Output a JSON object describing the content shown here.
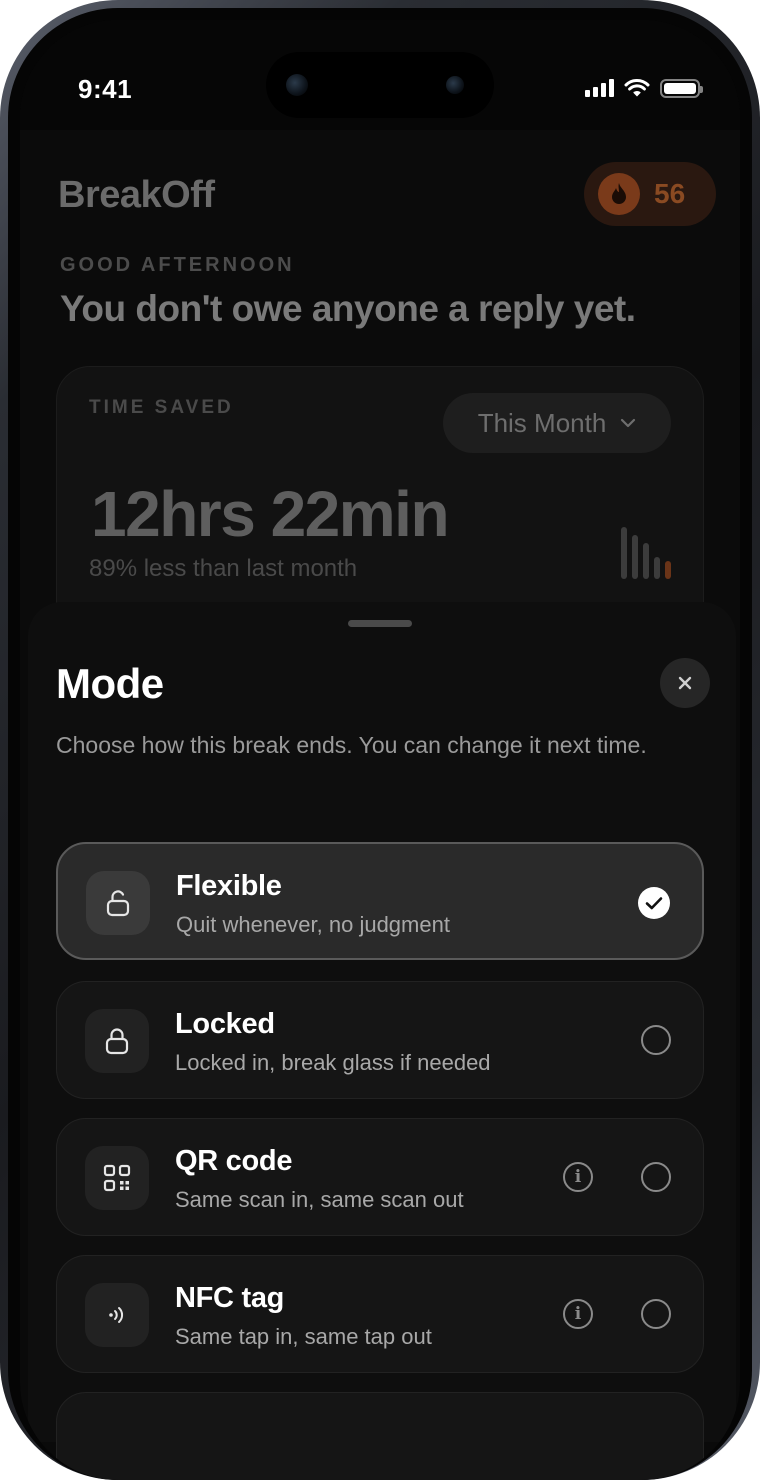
{
  "status_bar": {
    "time": "9:41"
  },
  "app": {
    "logo": "BreakOff",
    "streak_count": "56",
    "greeting": "GOOD AFTERNOON",
    "tagline": "You don't owe anyone a reply yet.",
    "time_saved_card": {
      "label": "TIME SAVED",
      "period": "This Month",
      "total": "12hrs 22min",
      "comparison": "89% less than last month"
    }
  },
  "sheet": {
    "title": "Mode",
    "subtitle": "Choose how this break ends. You can change it next time.",
    "options": [
      {
        "name": "Flexible",
        "description": "Quit whenever, no judgment",
        "icon": "unlock-icon",
        "selected": true
      },
      {
        "name": "Locked",
        "description": "Locked in, break glass if needed",
        "icon": "lock-icon",
        "selected": false
      },
      {
        "name": "QR code",
        "description": "Same scan in, same scan out",
        "icon": "qr-code-icon",
        "selected": false
      },
      {
        "name": "NFC tag",
        "description": "Same tap in, same tap out",
        "icon": "nfc-icon",
        "selected": false
      }
    ]
  },
  "colors": {
    "accent_orange": "#7a3a1a",
    "background": "#0a0a0a",
    "selected_border": "#5a5a5a"
  }
}
